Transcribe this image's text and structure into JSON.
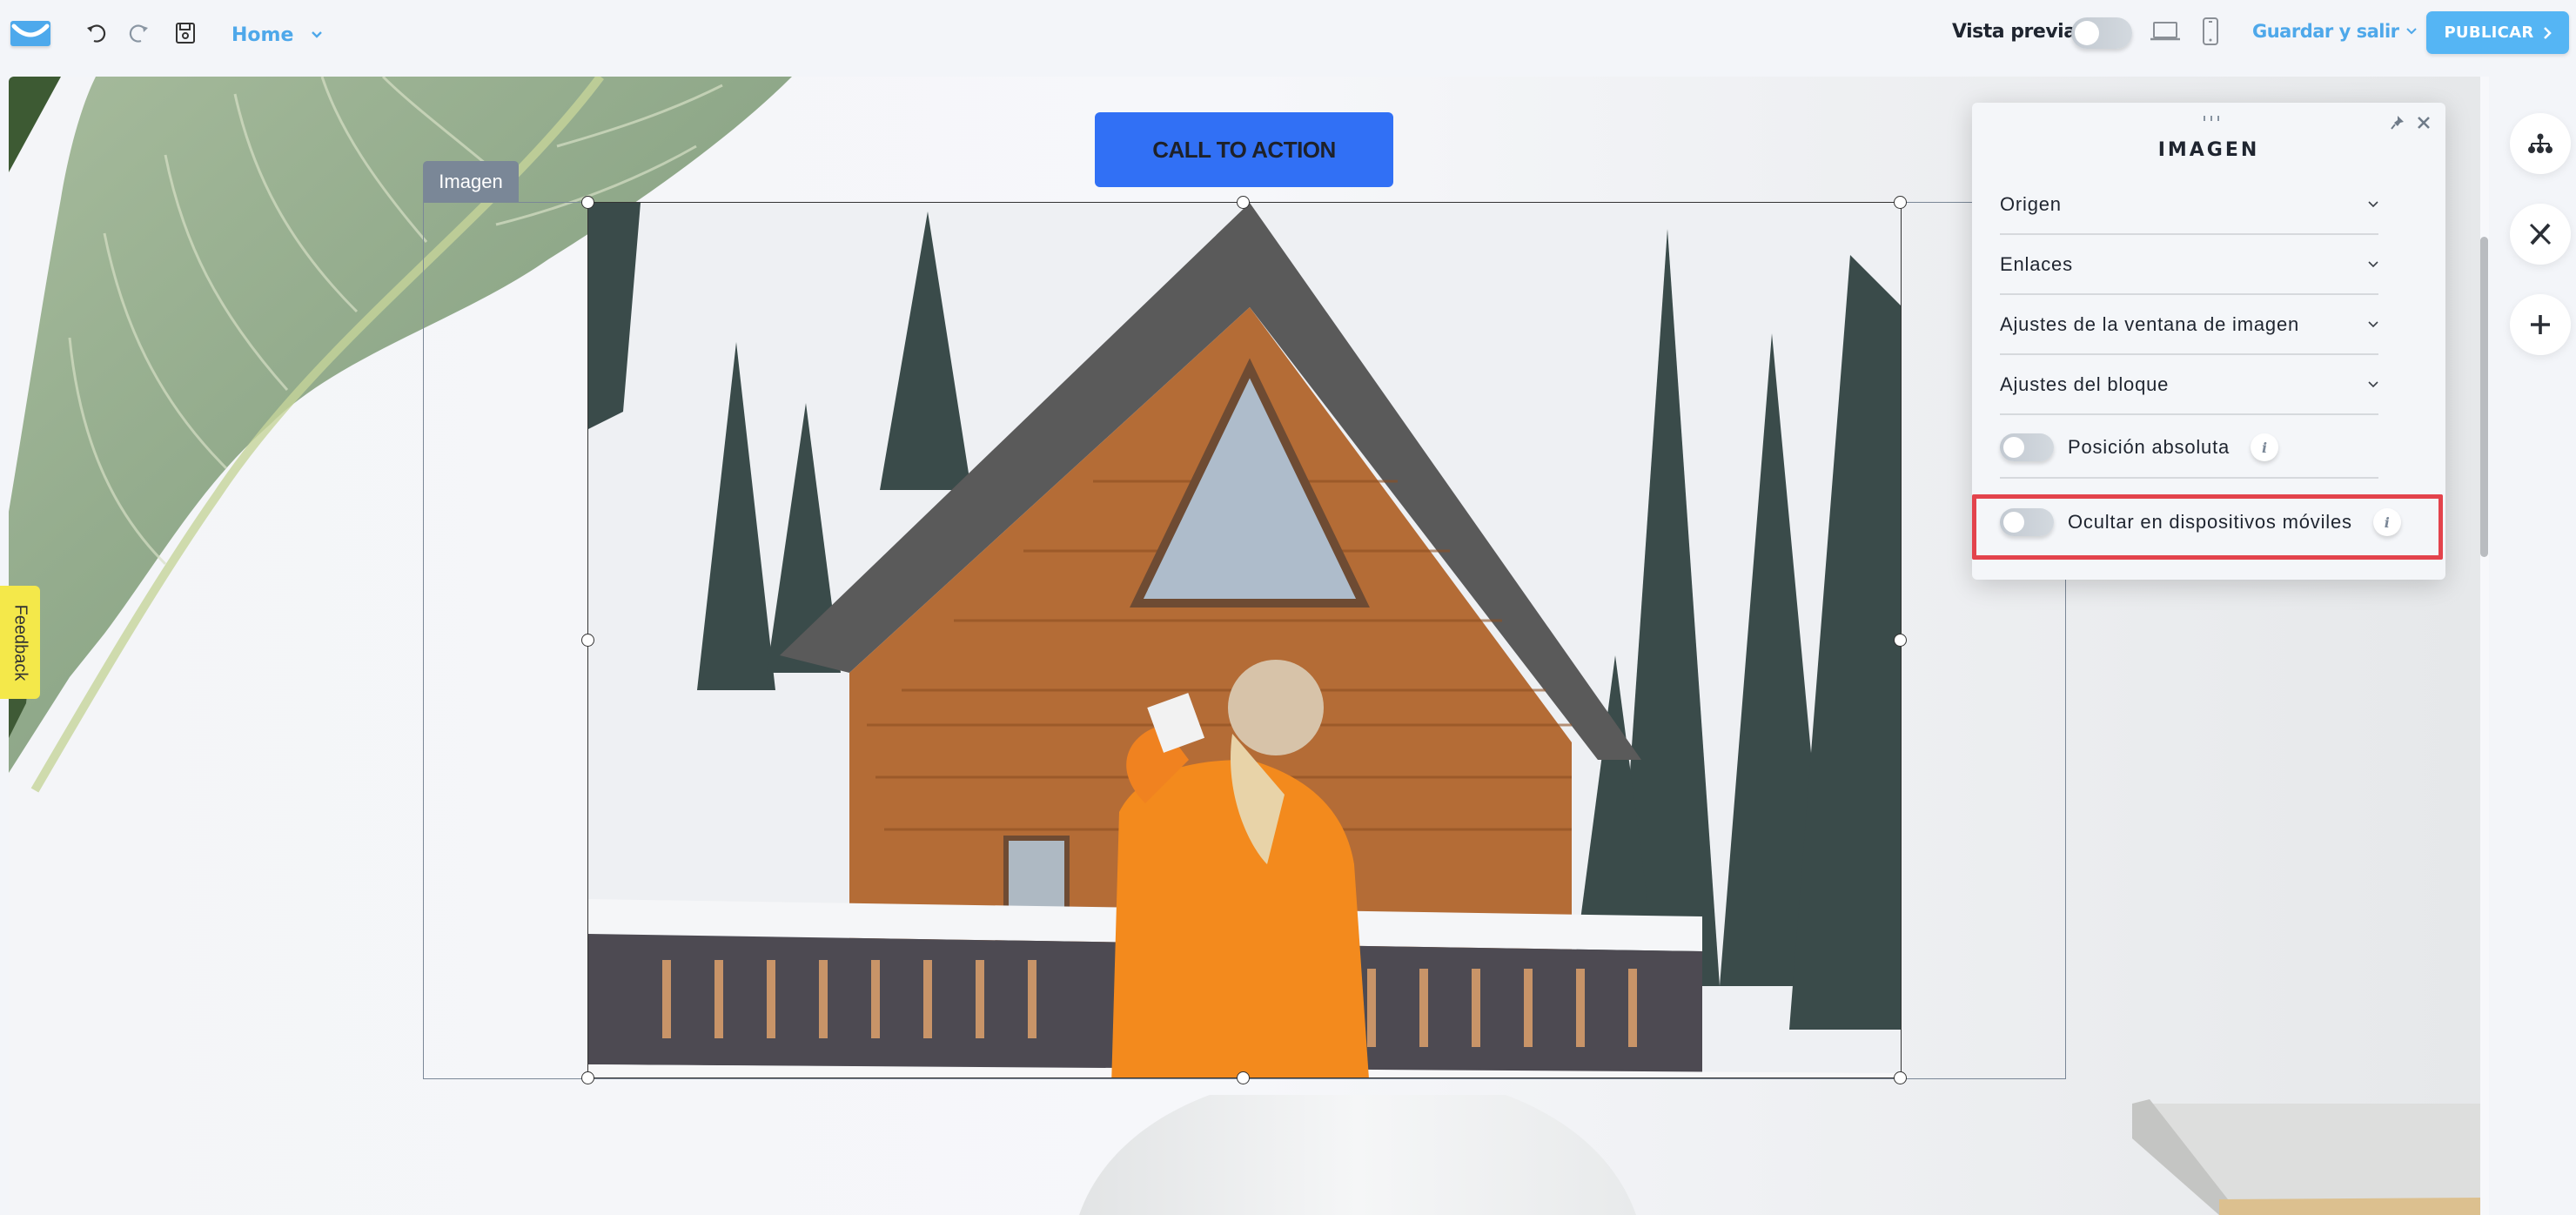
{
  "topbar": {
    "logo": "getresponse-logo",
    "undo_icon": "undo-icon",
    "redo_icon": "redo-icon",
    "save_icon": "save-icon",
    "page_selector": "Home",
    "preview_label": "Vista previa",
    "preview_enabled": false,
    "desktop_icon": "laptop-icon",
    "mobile_icon": "phone-icon",
    "save_exit_label": "Guardar y salir",
    "publish_label": "PUBLICAR"
  },
  "colors": {
    "accent": "#4ea8ea",
    "publish": "#55b5f4",
    "cta": "#3170f5",
    "highlight": "#e3434c",
    "feedback": "#f4e84a",
    "block_tag": "#7a8797"
  },
  "canvas": {
    "cta_label": "CALL TO ACTION",
    "block_tag": "Imagen",
    "feedback_label": "Feedback"
  },
  "panel": {
    "title": "IMAGEN",
    "sections": [
      {
        "label": "Origen"
      },
      {
        "label": "Enlaces"
      },
      {
        "label": "Ajustes de la ventana de imagen"
      },
      {
        "label": "Ajustes del bloque"
      }
    ],
    "toggles": [
      {
        "label": "Posición absoluta",
        "enabled": false,
        "info": "i"
      },
      {
        "label": "Ocultar en dispositivos móviles",
        "enabled": false,
        "info": "i"
      }
    ]
  },
  "side_tools": [
    {
      "icon": "sitemap-icon"
    },
    {
      "icon": "design-tools-icon"
    },
    {
      "icon": "add-icon"
    }
  ]
}
